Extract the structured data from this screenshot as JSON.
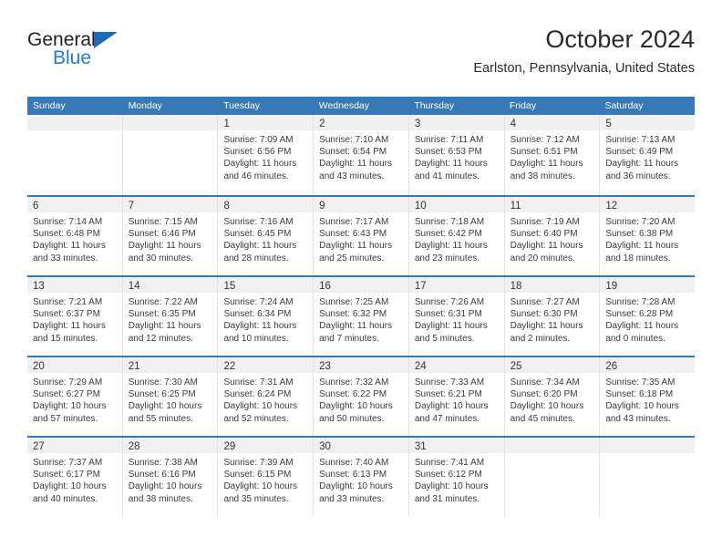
{
  "brand": {
    "name_top": "General",
    "name_bottom": "Blue",
    "triangle_icon": "triangle-icon",
    "color_dark": "#231f20",
    "color_blue": "#1f7fd0"
  },
  "header": {
    "title": "October 2024",
    "subtitle": "Earlston, Pennsylvania, United States"
  },
  "theme": {
    "header_blue": "#3679b6",
    "daynum_band": "#f0f0f0",
    "text": "#3a3a3a"
  },
  "calendar": {
    "weekday_headers": [
      "Sunday",
      "Monday",
      "Tuesday",
      "Wednesday",
      "Thursday",
      "Friday",
      "Saturday"
    ],
    "weeks": [
      [
        {
          "day": "",
          "sunrise": "",
          "sunset": "",
          "daylight_1": "",
          "daylight_2": ""
        },
        {
          "day": "",
          "sunrise": "",
          "sunset": "",
          "daylight_1": "",
          "daylight_2": ""
        },
        {
          "day": "1",
          "sunrise": "Sunrise: 7:09 AM",
          "sunset": "Sunset: 6:56 PM",
          "daylight_1": "Daylight: 11 hours",
          "daylight_2": "and 46 minutes."
        },
        {
          "day": "2",
          "sunrise": "Sunrise: 7:10 AM",
          "sunset": "Sunset: 6:54 PM",
          "daylight_1": "Daylight: 11 hours",
          "daylight_2": "and 43 minutes."
        },
        {
          "day": "3",
          "sunrise": "Sunrise: 7:11 AM",
          "sunset": "Sunset: 6:53 PM",
          "daylight_1": "Daylight: 11 hours",
          "daylight_2": "and 41 minutes."
        },
        {
          "day": "4",
          "sunrise": "Sunrise: 7:12 AM",
          "sunset": "Sunset: 6:51 PM",
          "daylight_1": "Daylight: 11 hours",
          "daylight_2": "and 38 minutes."
        },
        {
          "day": "5",
          "sunrise": "Sunrise: 7:13 AM",
          "sunset": "Sunset: 6:49 PM",
          "daylight_1": "Daylight: 11 hours",
          "daylight_2": "and 36 minutes."
        }
      ],
      [
        {
          "day": "6",
          "sunrise": "Sunrise: 7:14 AM",
          "sunset": "Sunset: 6:48 PM",
          "daylight_1": "Daylight: 11 hours",
          "daylight_2": "and 33 minutes."
        },
        {
          "day": "7",
          "sunrise": "Sunrise: 7:15 AM",
          "sunset": "Sunset: 6:46 PM",
          "daylight_1": "Daylight: 11 hours",
          "daylight_2": "and 30 minutes."
        },
        {
          "day": "8",
          "sunrise": "Sunrise: 7:16 AM",
          "sunset": "Sunset: 6:45 PM",
          "daylight_1": "Daylight: 11 hours",
          "daylight_2": "and 28 minutes."
        },
        {
          "day": "9",
          "sunrise": "Sunrise: 7:17 AM",
          "sunset": "Sunset: 6:43 PM",
          "daylight_1": "Daylight: 11 hours",
          "daylight_2": "and 25 minutes."
        },
        {
          "day": "10",
          "sunrise": "Sunrise: 7:18 AM",
          "sunset": "Sunset: 6:42 PM",
          "daylight_1": "Daylight: 11 hours",
          "daylight_2": "and 23 minutes."
        },
        {
          "day": "11",
          "sunrise": "Sunrise: 7:19 AM",
          "sunset": "Sunset: 6:40 PM",
          "daylight_1": "Daylight: 11 hours",
          "daylight_2": "and 20 minutes."
        },
        {
          "day": "12",
          "sunrise": "Sunrise: 7:20 AM",
          "sunset": "Sunset: 6:38 PM",
          "daylight_1": "Daylight: 11 hours",
          "daylight_2": "and 18 minutes."
        }
      ],
      [
        {
          "day": "13",
          "sunrise": "Sunrise: 7:21 AM",
          "sunset": "Sunset: 6:37 PM",
          "daylight_1": "Daylight: 11 hours",
          "daylight_2": "and 15 minutes."
        },
        {
          "day": "14",
          "sunrise": "Sunrise: 7:22 AM",
          "sunset": "Sunset: 6:35 PM",
          "daylight_1": "Daylight: 11 hours",
          "daylight_2": "and 12 minutes."
        },
        {
          "day": "15",
          "sunrise": "Sunrise: 7:24 AM",
          "sunset": "Sunset: 6:34 PM",
          "daylight_1": "Daylight: 11 hours",
          "daylight_2": "and 10 minutes."
        },
        {
          "day": "16",
          "sunrise": "Sunrise: 7:25 AM",
          "sunset": "Sunset: 6:32 PM",
          "daylight_1": "Daylight: 11 hours",
          "daylight_2": "and 7 minutes."
        },
        {
          "day": "17",
          "sunrise": "Sunrise: 7:26 AM",
          "sunset": "Sunset: 6:31 PM",
          "daylight_1": "Daylight: 11 hours",
          "daylight_2": "and 5 minutes."
        },
        {
          "day": "18",
          "sunrise": "Sunrise: 7:27 AM",
          "sunset": "Sunset: 6:30 PM",
          "daylight_1": "Daylight: 11 hours",
          "daylight_2": "and 2 minutes."
        },
        {
          "day": "19",
          "sunrise": "Sunrise: 7:28 AM",
          "sunset": "Sunset: 6:28 PM",
          "daylight_1": "Daylight: 11 hours",
          "daylight_2": "and 0 minutes."
        }
      ],
      [
        {
          "day": "20",
          "sunrise": "Sunrise: 7:29 AM",
          "sunset": "Sunset: 6:27 PM",
          "daylight_1": "Daylight: 10 hours",
          "daylight_2": "and 57 minutes."
        },
        {
          "day": "21",
          "sunrise": "Sunrise: 7:30 AM",
          "sunset": "Sunset: 6:25 PM",
          "daylight_1": "Daylight: 10 hours",
          "daylight_2": "and 55 minutes."
        },
        {
          "day": "22",
          "sunrise": "Sunrise: 7:31 AM",
          "sunset": "Sunset: 6:24 PM",
          "daylight_1": "Daylight: 10 hours",
          "daylight_2": "and 52 minutes."
        },
        {
          "day": "23",
          "sunrise": "Sunrise: 7:32 AM",
          "sunset": "Sunset: 6:22 PM",
          "daylight_1": "Daylight: 10 hours",
          "daylight_2": "and 50 minutes."
        },
        {
          "day": "24",
          "sunrise": "Sunrise: 7:33 AM",
          "sunset": "Sunset: 6:21 PM",
          "daylight_1": "Daylight: 10 hours",
          "daylight_2": "and 47 minutes."
        },
        {
          "day": "25",
          "sunrise": "Sunrise: 7:34 AM",
          "sunset": "Sunset: 6:20 PM",
          "daylight_1": "Daylight: 10 hours",
          "daylight_2": "and 45 minutes."
        },
        {
          "day": "26",
          "sunrise": "Sunrise: 7:35 AM",
          "sunset": "Sunset: 6:18 PM",
          "daylight_1": "Daylight: 10 hours",
          "daylight_2": "and 43 minutes."
        }
      ],
      [
        {
          "day": "27",
          "sunrise": "Sunrise: 7:37 AM",
          "sunset": "Sunset: 6:17 PM",
          "daylight_1": "Daylight: 10 hours",
          "daylight_2": "and 40 minutes."
        },
        {
          "day": "28",
          "sunrise": "Sunrise: 7:38 AM",
          "sunset": "Sunset: 6:16 PM",
          "daylight_1": "Daylight: 10 hours",
          "daylight_2": "and 38 minutes."
        },
        {
          "day": "29",
          "sunrise": "Sunrise: 7:39 AM",
          "sunset": "Sunset: 6:15 PM",
          "daylight_1": "Daylight: 10 hours",
          "daylight_2": "and 35 minutes."
        },
        {
          "day": "30",
          "sunrise": "Sunrise: 7:40 AM",
          "sunset": "Sunset: 6:13 PM",
          "daylight_1": "Daylight: 10 hours",
          "daylight_2": "and 33 minutes."
        },
        {
          "day": "31",
          "sunrise": "Sunrise: 7:41 AM",
          "sunset": "Sunset: 6:12 PM",
          "daylight_1": "Daylight: 10 hours",
          "daylight_2": "and 31 minutes."
        },
        {
          "day": "",
          "sunrise": "",
          "sunset": "",
          "daylight_1": "",
          "daylight_2": ""
        },
        {
          "day": "",
          "sunrise": "",
          "sunset": "",
          "daylight_1": "",
          "daylight_2": ""
        }
      ]
    ]
  }
}
